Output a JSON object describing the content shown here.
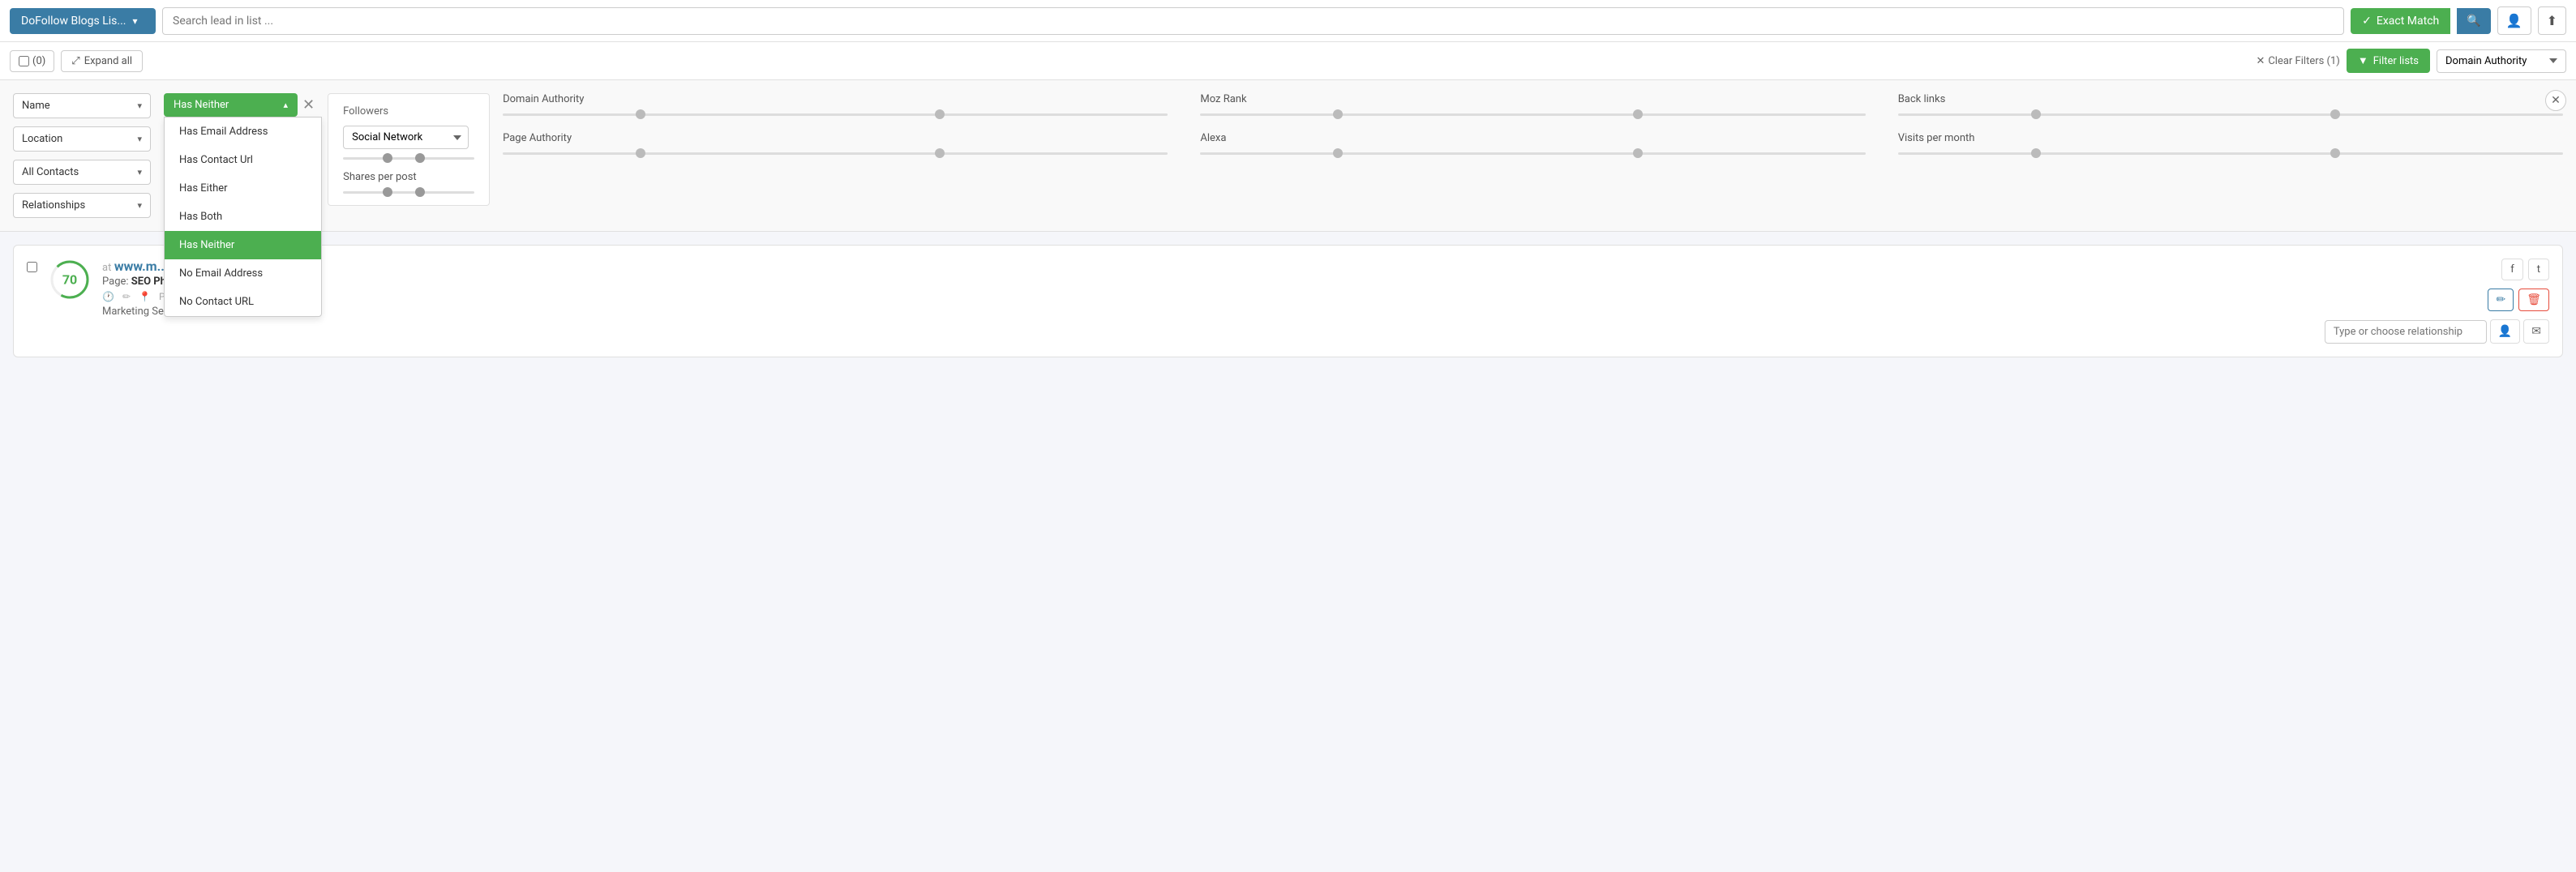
{
  "topbar": {
    "list_selector_label": "DoFollow Blogs Lis...",
    "search_placeholder": "Search lead in list ...",
    "exact_match_label": "Exact Match",
    "avatar_icon": "👤",
    "upload_icon": "⬆"
  },
  "secondbar": {
    "checkbox_count": "(0)",
    "expand_all_label": "Expand all",
    "clear_filters_label": "Clear Filters (1)",
    "filter_lists_label": "Filter lists",
    "domain_authority_label": "Domain Authority"
  },
  "filters": {
    "name_label": "Name",
    "location_label": "Location",
    "all_contacts_label": "All Contacts",
    "relationships_label": "Relationships",
    "has_neither_label": "Has Neither",
    "followers_label": "Followers",
    "social_network_label": "Social Network",
    "shares_per_post_label": "Shares per post",
    "domain_authority_label": "Domain Authority",
    "moz_rank_label": "Moz Rank",
    "back_links_label": "Back links",
    "page_authority_label": "Page Authority",
    "alexa_label": "Alexa",
    "visits_per_month_label": "Visits per month",
    "dropdown_items": [
      {
        "label": "Has Email Address",
        "active": false
      },
      {
        "label": "Has Contact Url",
        "active": false
      },
      {
        "label": "Has Either",
        "active": false
      },
      {
        "label": "Has Both",
        "active": false
      },
      {
        "label": "Has Neither",
        "active": true
      },
      {
        "label": "No Email Address",
        "active": false
      },
      {
        "label": "No Contact URL",
        "active": false
      }
    ]
  },
  "lead": {
    "score": "70",
    "at_sign": "at",
    "url": "www.m...",
    "page_label": "Page:",
    "page_name": "SEO Phi...",
    "location": "Phill...",
    "tags": "Marketing Services",
    "facebook_label": "f",
    "twitter_label": "t",
    "edit_icon": "✏",
    "delete_icon": "🗑",
    "relationship_placeholder": "Type or choose relationship",
    "person_icon": "👤",
    "email_icon": "✉"
  },
  "icons": {
    "check": "✓",
    "search": "🔍",
    "expand": "⤢",
    "clear_x": "✕",
    "filter_icon": "▼",
    "funnel": "⊿",
    "clock": "🕐",
    "edit_small": "✏",
    "pin": "📍",
    "chevron_down": "▾",
    "chevron_up": "▴",
    "close_x": "✕"
  }
}
